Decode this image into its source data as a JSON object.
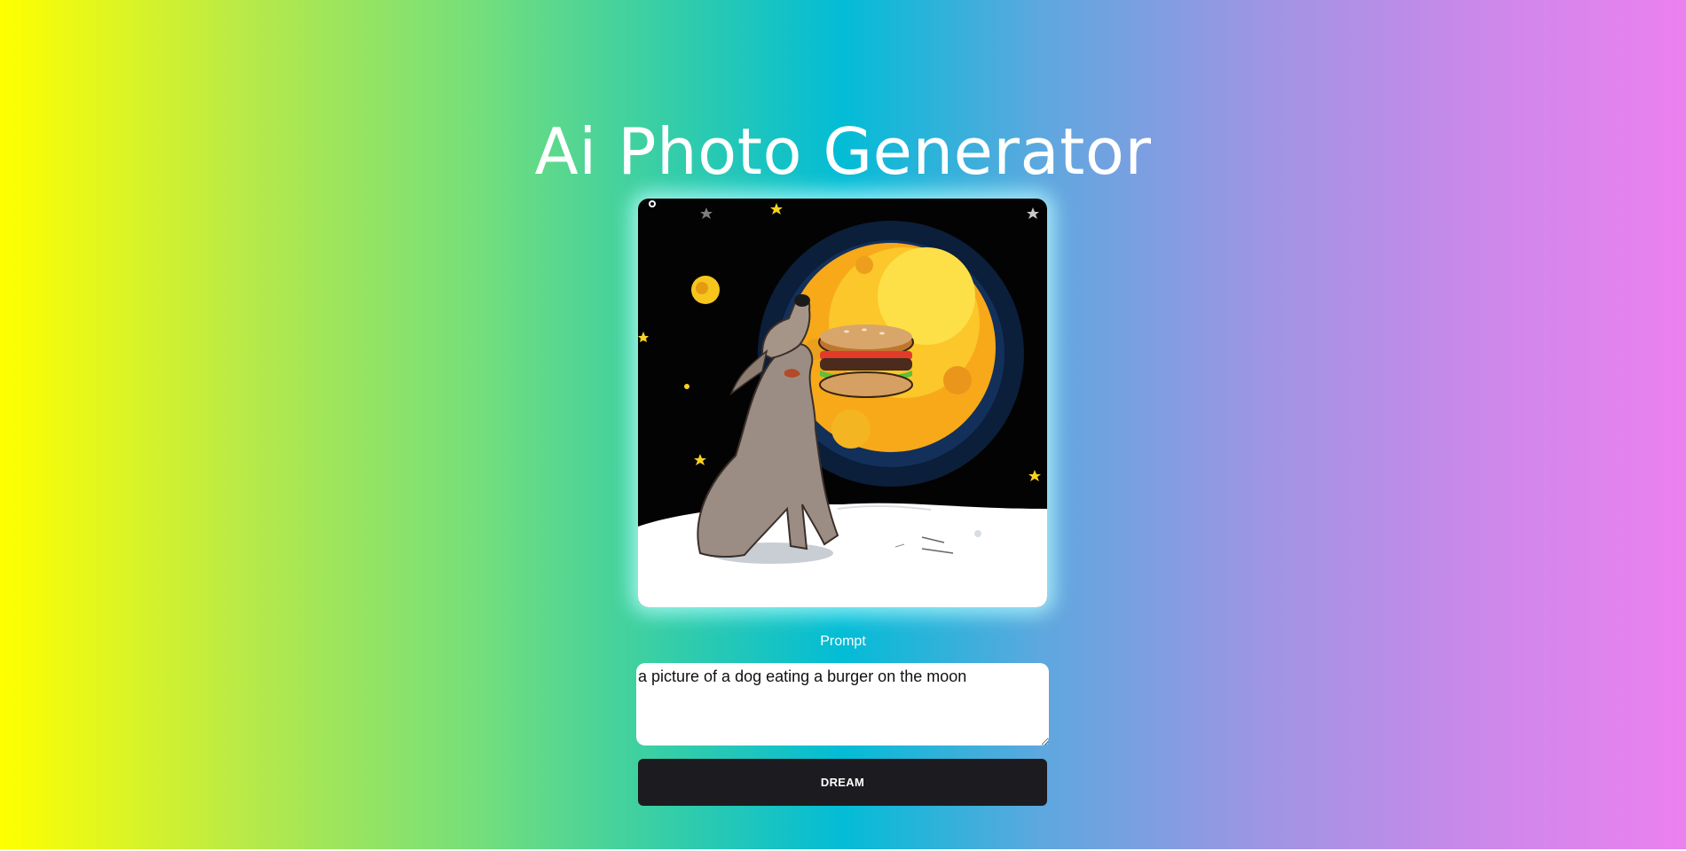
{
  "header": {
    "title": "Ai Photo Generator"
  },
  "generated_image": {
    "icon": "dog-eating-burger-on-moon-illustration"
  },
  "prompt": {
    "label": "Prompt",
    "value": "a picture of a dog eating a burger on the moon"
  },
  "actions": {
    "dream_label": "DREAM"
  },
  "colors": {
    "gradient": [
      "#ffff00",
      "#76df7a",
      "#03bcd6",
      "#9f95e3",
      "#ec80ef"
    ],
    "button_bg": "#1c1c20",
    "text_light": "#ffffff"
  }
}
